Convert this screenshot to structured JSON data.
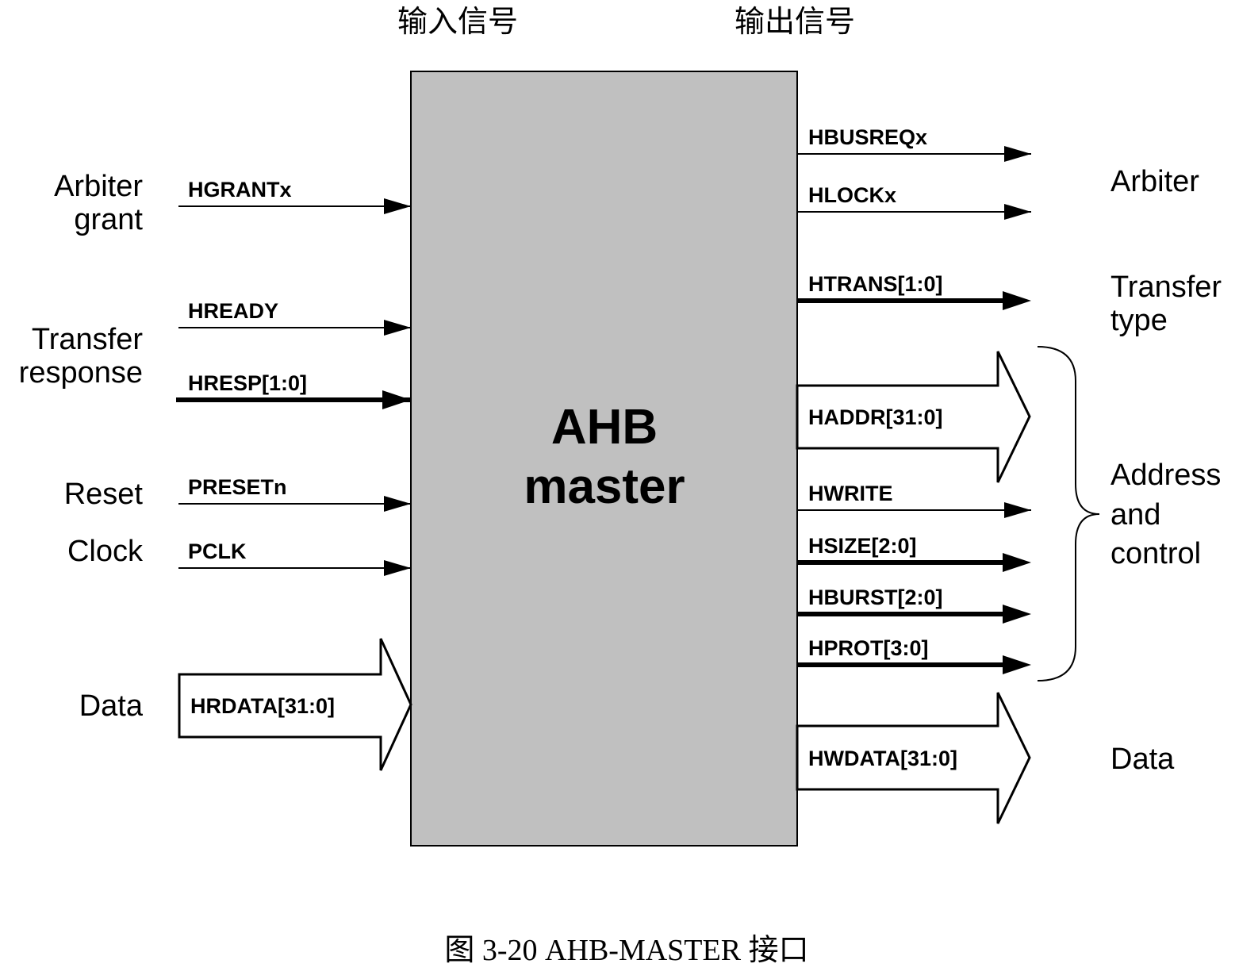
{
  "headers": {
    "inputs": "输入信号",
    "outputs": "输出信号"
  },
  "block": {
    "line1": "AHB",
    "line2": "master",
    "fill": "#c0c0c0"
  },
  "left_groups": {
    "arbiter_grant": [
      "Arbiter",
      "grant"
    ],
    "transfer_response": [
      "Transfer",
      "response"
    ],
    "reset": "Reset",
    "clock": "Clock",
    "data": "Data"
  },
  "inputs": {
    "hgrant": "HGRANTx",
    "hready": "HREADY",
    "hresp": "HRESP[1:0]",
    "preset": "PRESETn",
    "pclk": "PCLK",
    "hrdata": "HRDATA[31:0]"
  },
  "outputs": {
    "hbusreq": "HBUSREQx",
    "hlock": "HLOCKx",
    "htrans": "HTRANS[1:0]",
    "haddr": "HADDR[31:0]",
    "hwrite": "HWRITE",
    "hsize": "HSIZE[2:0]",
    "hburst": "HBURST[2:0]",
    "hprot": "HPROT[3:0]",
    "hwdata": "HWDATA[31:0]"
  },
  "right_groups": {
    "arbiter": "Arbiter",
    "transfer_type": [
      "Transfer",
      "type"
    ],
    "address_control": [
      "Address",
      "and",
      "control"
    ],
    "data": "Data"
  },
  "caption": "图 3-20 AHB-MASTER 接口"
}
